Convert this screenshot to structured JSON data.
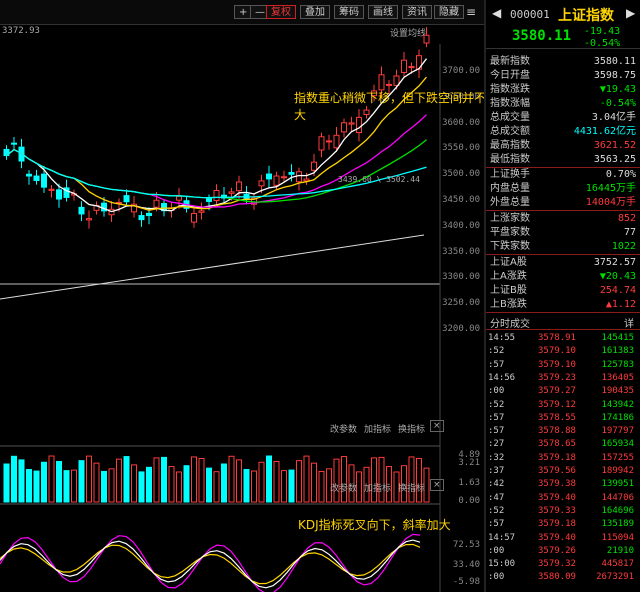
{
  "toolbar": {
    "buttons": [
      "+",
      "—",
      "复权",
      "叠加",
      "筹码",
      "画线",
      "资讯",
      "隐藏"
    ],
    "menu_icon": "≡"
  },
  "chart": {
    "top_left_label": "3372.93",
    "ma_label": "设置均线",
    "price_axis": [
      "3700.00",
      "3650.00",
      "3600.00",
      "3550.00",
      "3500.00",
      "3450.00",
      "3400.00",
      "3350.00",
      "3300.00",
      "3250.00",
      "3200.00"
    ],
    "ma_note": "3439.60 \\ 3502.44",
    "annotation_price": "指数重心稍微下移，但下跌空间并不大",
    "annotation_kdj": "KDJ指标死叉向下，斜率加大",
    "vol_panel_buttons": [
      "改参数",
      "加指标",
      "换指标"
    ],
    "vol_axis": [
      "4.89",
      "3.21",
      "1.63",
      "0.00"
    ],
    "kdj_panel_buttons": [
      "改参数",
      "加指标",
      "换指标"
    ],
    "kdj_axis": [
      "72.53",
      "33.40",
      "-5.98"
    ],
    "close_icon": "×"
  },
  "quote": {
    "code": "000001",
    "name": "上证指数",
    "price": "3580.11",
    "change": "-19.43",
    "change_pct": "-0.54%",
    "rows1": [
      {
        "label": "最新指数",
        "value": "3580.11",
        "color": "white"
      },
      {
        "label": "今日开盘",
        "value": "3598.75",
        "color": "white"
      },
      {
        "label": "指数涨跌",
        "value": "▼19.43",
        "color": "green"
      },
      {
        "label": "指数涨幅",
        "value": "-0.54%",
        "color": "green"
      },
      {
        "label": "总成交量",
        "value": "3.04亿手",
        "color": "white"
      },
      {
        "label": "总成交额",
        "value": "4431.62亿元",
        "color": "cyan"
      },
      {
        "label": "最高指数",
        "value": "3621.52",
        "color": "red"
      },
      {
        "label": "最低指数",
        "value": "3563.25",
        "color": "white"
      }
    ],
    "rows2": [
      {
        "label": "上证换手",
        "value": "0.70%",
        "color": "white"
      },
      {
        "label": "内盘总量",
        "value": "16445万手",
        "color": "green"
      },
      {
        "label": "外盘总量",
        "value": "14004万手",
        "color": "red"
      }
    ],
    "rows3": [
      {
        "label": "上涨家数",
        "value": "852",
        "color": "red"
      },
      {
        "label": "平盘家数",
        "value": "77",
        "color": "white"
      },
      {
        "label": "下跌家数",
        "value": "1022",
        "color": "green"
      }
    ],
    "rows4": [
      {
        "label": "上证A股",
        "value": "3752.57",
        "color": "white"
      },
      {
        "label": "上A涨跌",
        "value": "▼20.43",
        "color": "green"
      },
      {
        "label": "上证B股",
        "value": "254.74",
        "color": "red"
      },
      {
        "label": "上B涨跌",
        "value": "▲1.12",
        "color": "red"
      }
    ],
    "ticks_title": "分时成交",
    "ticks_btn": "详",
    "ticks": [
      {
        "time": "14:55",
        "price": "3578.91",
        "vol": "145415",
        "color": "green"
      },
      {
        "time": ":52",
        "price": "3579.10",
        "vol": "161383",
        "color": "green"
      },
      {
        "time": ":57",
        "price": "3579.10",
        "vol": "125783",
        "color": "green"
      },
      {
        "time": "14:56",
        "price": "3579.23",
        "vol": "136405",
        "color": "red"
      },
      {
        "time": ":00",
        "price": "3579.27",
        "vol": "190435",
        "color": "red"
      },
      {
        "time": ":52",
        "price": "3579.12",
        "vol": "143942",
        "color": "green"
      },
      {
        "time": ":57",
        "price": "3578.55",
        "vol": "174186",
        "color": "green"
      },
      {
        "time": ":57",
        "price": "3578.88",
        "vol": "197797",
        "color": "red"
      },
      {
        "time": ":27",
        "price": "3578.65",
        "vol": "165934",
        "color": "green"
      },
      {
        "time": ":32",
        "price": "3579.18",
        "vol": "157255",
        "color": "red"
      },
      {
        "time": ":37",
        "price": "3579.56",
        "vol": "189942",
        "color": "red"
      },
      {
        "time": ":42",
        "price": "3579.38",
        "vol": "139951",
        "color": "green"
      },
      {
        "time": ":47",
        "price": "3579.40",
        "vol": "144706",
        "color": "red"
      },
      {
        "time": ":52",
        "price": "3579.33",
        "vol": "164696",
        "color": "green"
      },
      {
        "time": ":57",
        "price": "3579.18",
        "vol": "135189",
        "color": "green"
      },
      {
        "time": "14:57",
        "price": "3579.40",
        "vol": "115094",
        "color": "red"
      },
      {
        "time": ":00",
        "price": "3579.26",
        "vol": "21910",
        "color": "green"
      },
      {
        "time": "15:00",
        "price": "3579.32",
        "vol": "445817",
        "color": "red"
      },
      {
        "time": ":00",
        "price": "3580.09",
        "vol": "2673291",
        "color": "red"
      }
    ]
  }
}
